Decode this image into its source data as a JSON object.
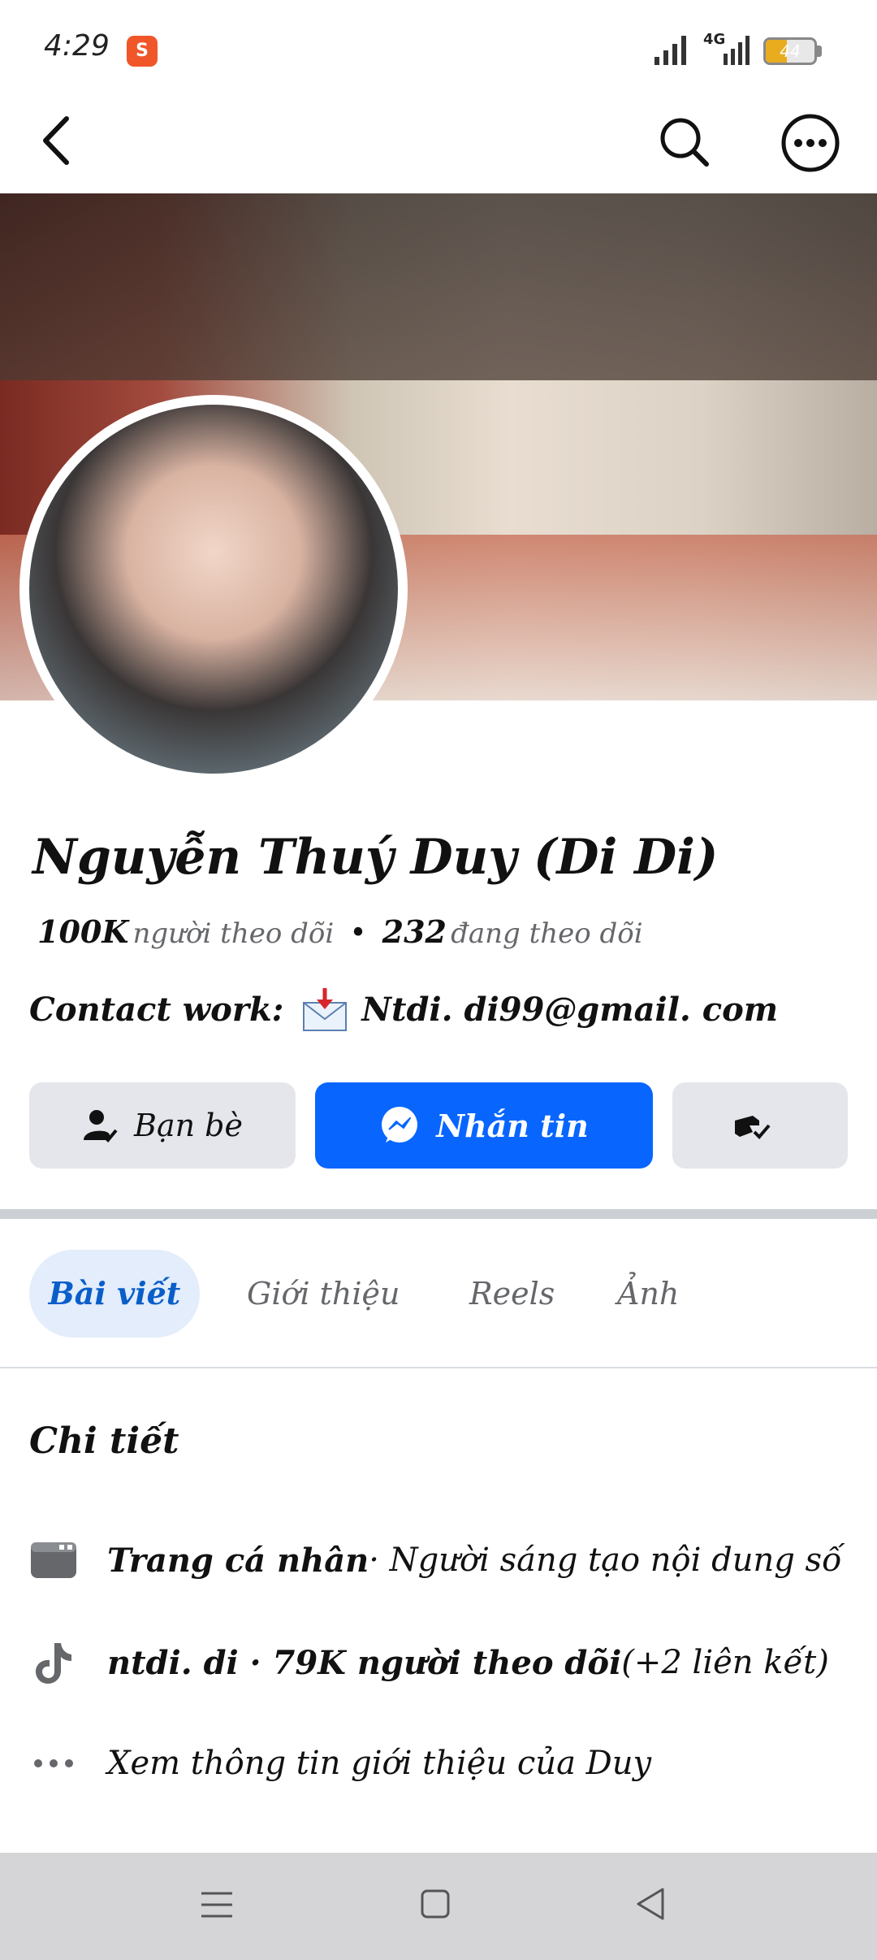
{
  "status_bar": {
    "time": "4:29",
    "app_notification_icon": "shopee-icon",
    "network": "4G",
    "battery_level": "44",
    "battery_fraction": 0.44
  },
  "nav": {
    "back_icon": "chevron-left-icon",
    "search_icon": "search-icon",
    "more_icon": "more-horizontal-icon"
  },
  "profile": {
    "name": "Nguyễn Thuý Duy (Di Di)",
    "followers_count": "100K",
    "followers_label": "người theo dõi",
    "separator": "•",
    "following_count": "232",
    "following_label": "đang theo dõi",
    "contact_prefix": "Contact work:",
    "contact_email": "Ntdi. di99@gmail. com"
  },
  "actions": {
    "friends_label": "Bạn bè",
    "message_label": "Nhắn tin",
    "extra_icon": "hand-check-icon"
  },
  "tabs": [
    {
      "label": "Bài viết",
      "active": true
    },
    {
      "label": "Giới thiệu",
      "active": false
    },
    {
      "label": "Reels",
      "active": false
    },
    {
      "label": "Ảnh",
      "active": false
    }
  ],
  "details": {
    "title": "Chi tiết",
    "items": [
      {
        "icon": "page-icon",
        "bold": "Trang cá nhân",
        "text": " · Người sáng tạo nội dung số"
      },
      {
        "icon": "tiktok-icon",
        "bold": "ntdi. di · 79K người theo dõi",
        "text": " (+2 liên kết)"
      },
      {
        "icon": "ellipsis-icon",
        "bold": "",
        "text": "Xem thông tin giới thiệu của Duy"
      }
    ]
  },
  "system_nav": {
    "menu_icon": "menu-icon",
    "home_icon": "home-square-icon",
    "back_icon": "back-triangle-icon"
  },
  "colors": {
    "accent": "#0866ff",
    "tab_active_bg": "#e3edfb",
    "button_gray": "#e4e6eb",
    "battery": "#e9ac1e"
  }
}
